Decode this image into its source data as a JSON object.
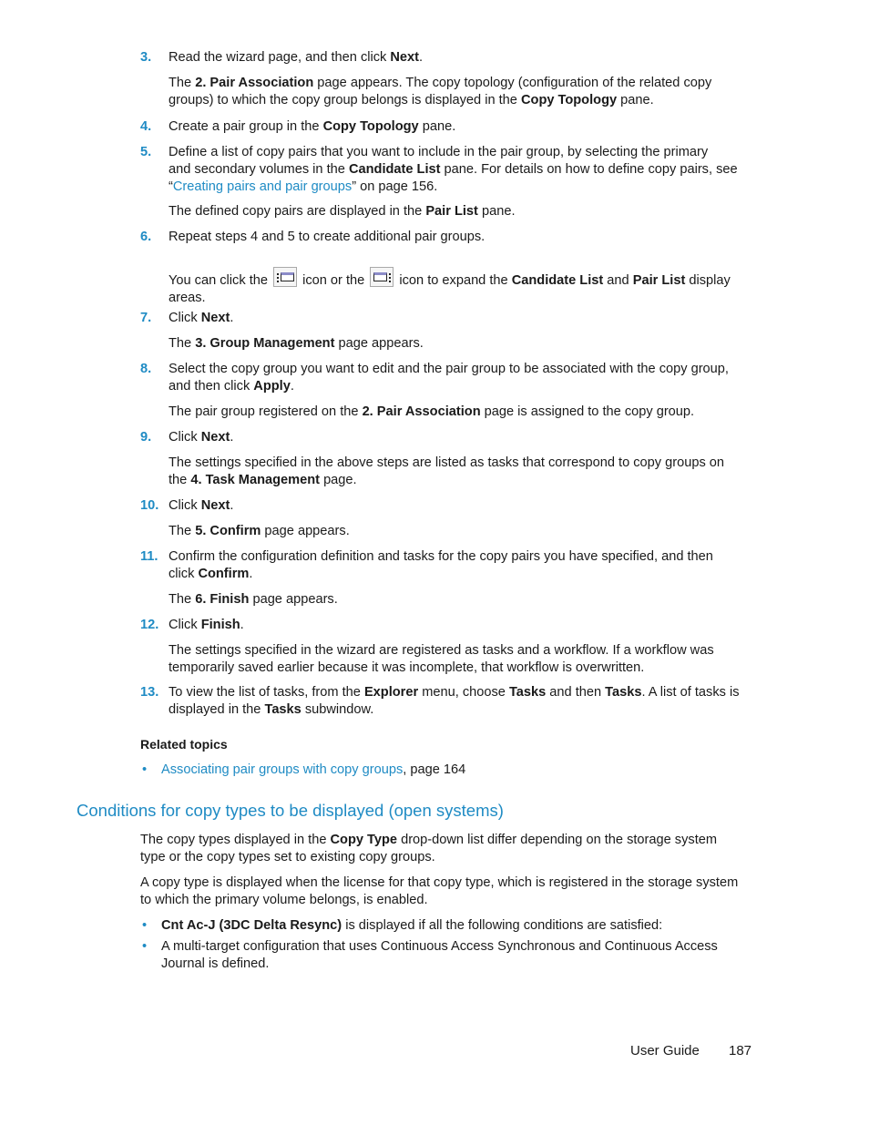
{
  "steps": [
    {
      "num": "3.",
      "text_a": "Read the wizard page, and then click ",
      "b1": "Next",
      "text_b": "."
    },
    {
      "num": "4.",
      "text_a": "Create a pair group in the ",
      "b1": "Copy Topology",
      "text_b": " pane."
    },
    {
      "num": "5.",
      "line1": "Define a list of copy pairs that you want to include in the pair group, by selecting the primary",
      "line2a": "and secondary volumes in the ",
      "b1": "Candidate List",
      "line2b": " pane. For details on how to define copy pairs, see",
      "quote_open": "“",
      "link": "Creating pairs and pair groups",
      "line3b": "” on page 156."
    },
    {
      "num": "6.",
      "text_a": "Repeat steps 4 and 5 to create additional pair groups."
    },
    {
      "num": "7.",
      "text_a": "Click ",
      "b1": "Next",
      "text_b": "."
    },
    {
      "num": "8.",
      "line1": "Select the copy group you want to edit and the pair group to be associated with the copy group,",
      "line2a": "and then click ",
      "b1": "Apply",
      "line2b": "."
    },
    {
      "num": "9.",
      "text_a": "Click ",
      "b1": "Next",
      "text_b": "."
    },
    {
      "num": "10.",
      "text_a": "Click ",
      "b1": "Next",
      "text_b": "."
    },
    {
      "num": "11.",
      "line1": "Confirm the configuration definition and tasks for the copy pairs you have specified, and then",
      "line2a": "click ",
      "b1": "Confirm",
      "line2b": "."
    },
    {
      "num": "12.",
      "text_a": "Click ",
      "b1": "Finish",
      "text_b": "."
    },
    {
      "num": "13.",
      "line1a": "To view the list of tasks, from the ",
      "b1": "Explorer",
      "line1b": " menu, choose ",
      "b2": "Tasks",
      "line1c": " and then ",
      "b3": "Tasks",
      "line1d": ". A list of tasks is",
      "line2a": "displayed in the ",
      "b4": "Tasks",
      "line2b": " subwindow."
    }
  ],
  "paras": {
    "p3a": "The ",
    "p3b": "2. Pair Association",
    "p3c": " page appears. The copy topology (configuration of the related copy",
    "p3d": "groups) to which the copy group belongs is displayed in the ",
    "p3e": "Copy Topology",
    "p3f": " pane.",
    "p5a": "The defined copy pairs are displayed in the ",
    "p5b": "Pair List",
    "p5c": " pane.",
    "p6a": "You can click the ",
    "p6b": " icon or the ",
    "p6c": " icon to expand the ",
    "p6d": "Candidate List",
    "p6e": " and ",
    "p6f": "Pair List",
    "p6g": " display",
    "p6h": "areas.",
    "p7a": "The ",
    "p7b": "3. Group Management",
    "p7c": " page appears.",
    "p8a": "The pair group registered on the ",
    "p8b": "2. Pair Association",
    "p8c": " page is assigned to the copy group.",
    "p9a": "The settings specified in the above steps are listed as tasks that correspond to copy groups on",
    "p9b": "the ",
    "p9c": "4. Task Management",
    "p9d": " page.",
    "p10a": "The ",
    "p10b": "5. Confirm",
    "p10c": " page appears.",
    "p11a": "The ",
    "p11b": "6. Finish",
    "p11c": " page appears.",
    "p12a": "The settings specified in the wizard are registered as tasks and a workflow. If a workflow was",
    "p12b": "temporarily saved earlier because it was incomplete, that workflow is overwritten."
  },
  "related": {
    "title": "Related topics",
    "bullet": "•",
    "link": "Associating pair groups with copy groups",
    "suffix": ", page 164"
  },
  "section": {
    "heading": "Conditions for copy types to be displayed (open systems)",
    "p1a": "The copy types displayed in the ",
    "p1b": "Copy Type",
    "p1c": " drop-down list differ depending on the storage system",
    "p1d": "type or the copy types set to existing copy groups.",
    "p2a": "A copy type is displayed when the license for that copy type, which is registered in the storage system",
    "p2b": "to which the primary volume belongs, is enabled.",
    "b1a": "Cnt Ac-J (3DC Delta Resync)",
    "b1b": " is displayed if all the following conditions are satisfied:",
    "b2a": "A multi-target configuration that uses Continuous Access Synchronous and Continuous Access",
    "b2b": "Journal is defined."
  },
  "icons": {
    "expand_left": "expand-candidate-list-icon",
    "expand_right": "expand-pair-list-icon"
  },
  "footer": {
    "label": "User Guide",
    "page": "187"
  }
}
